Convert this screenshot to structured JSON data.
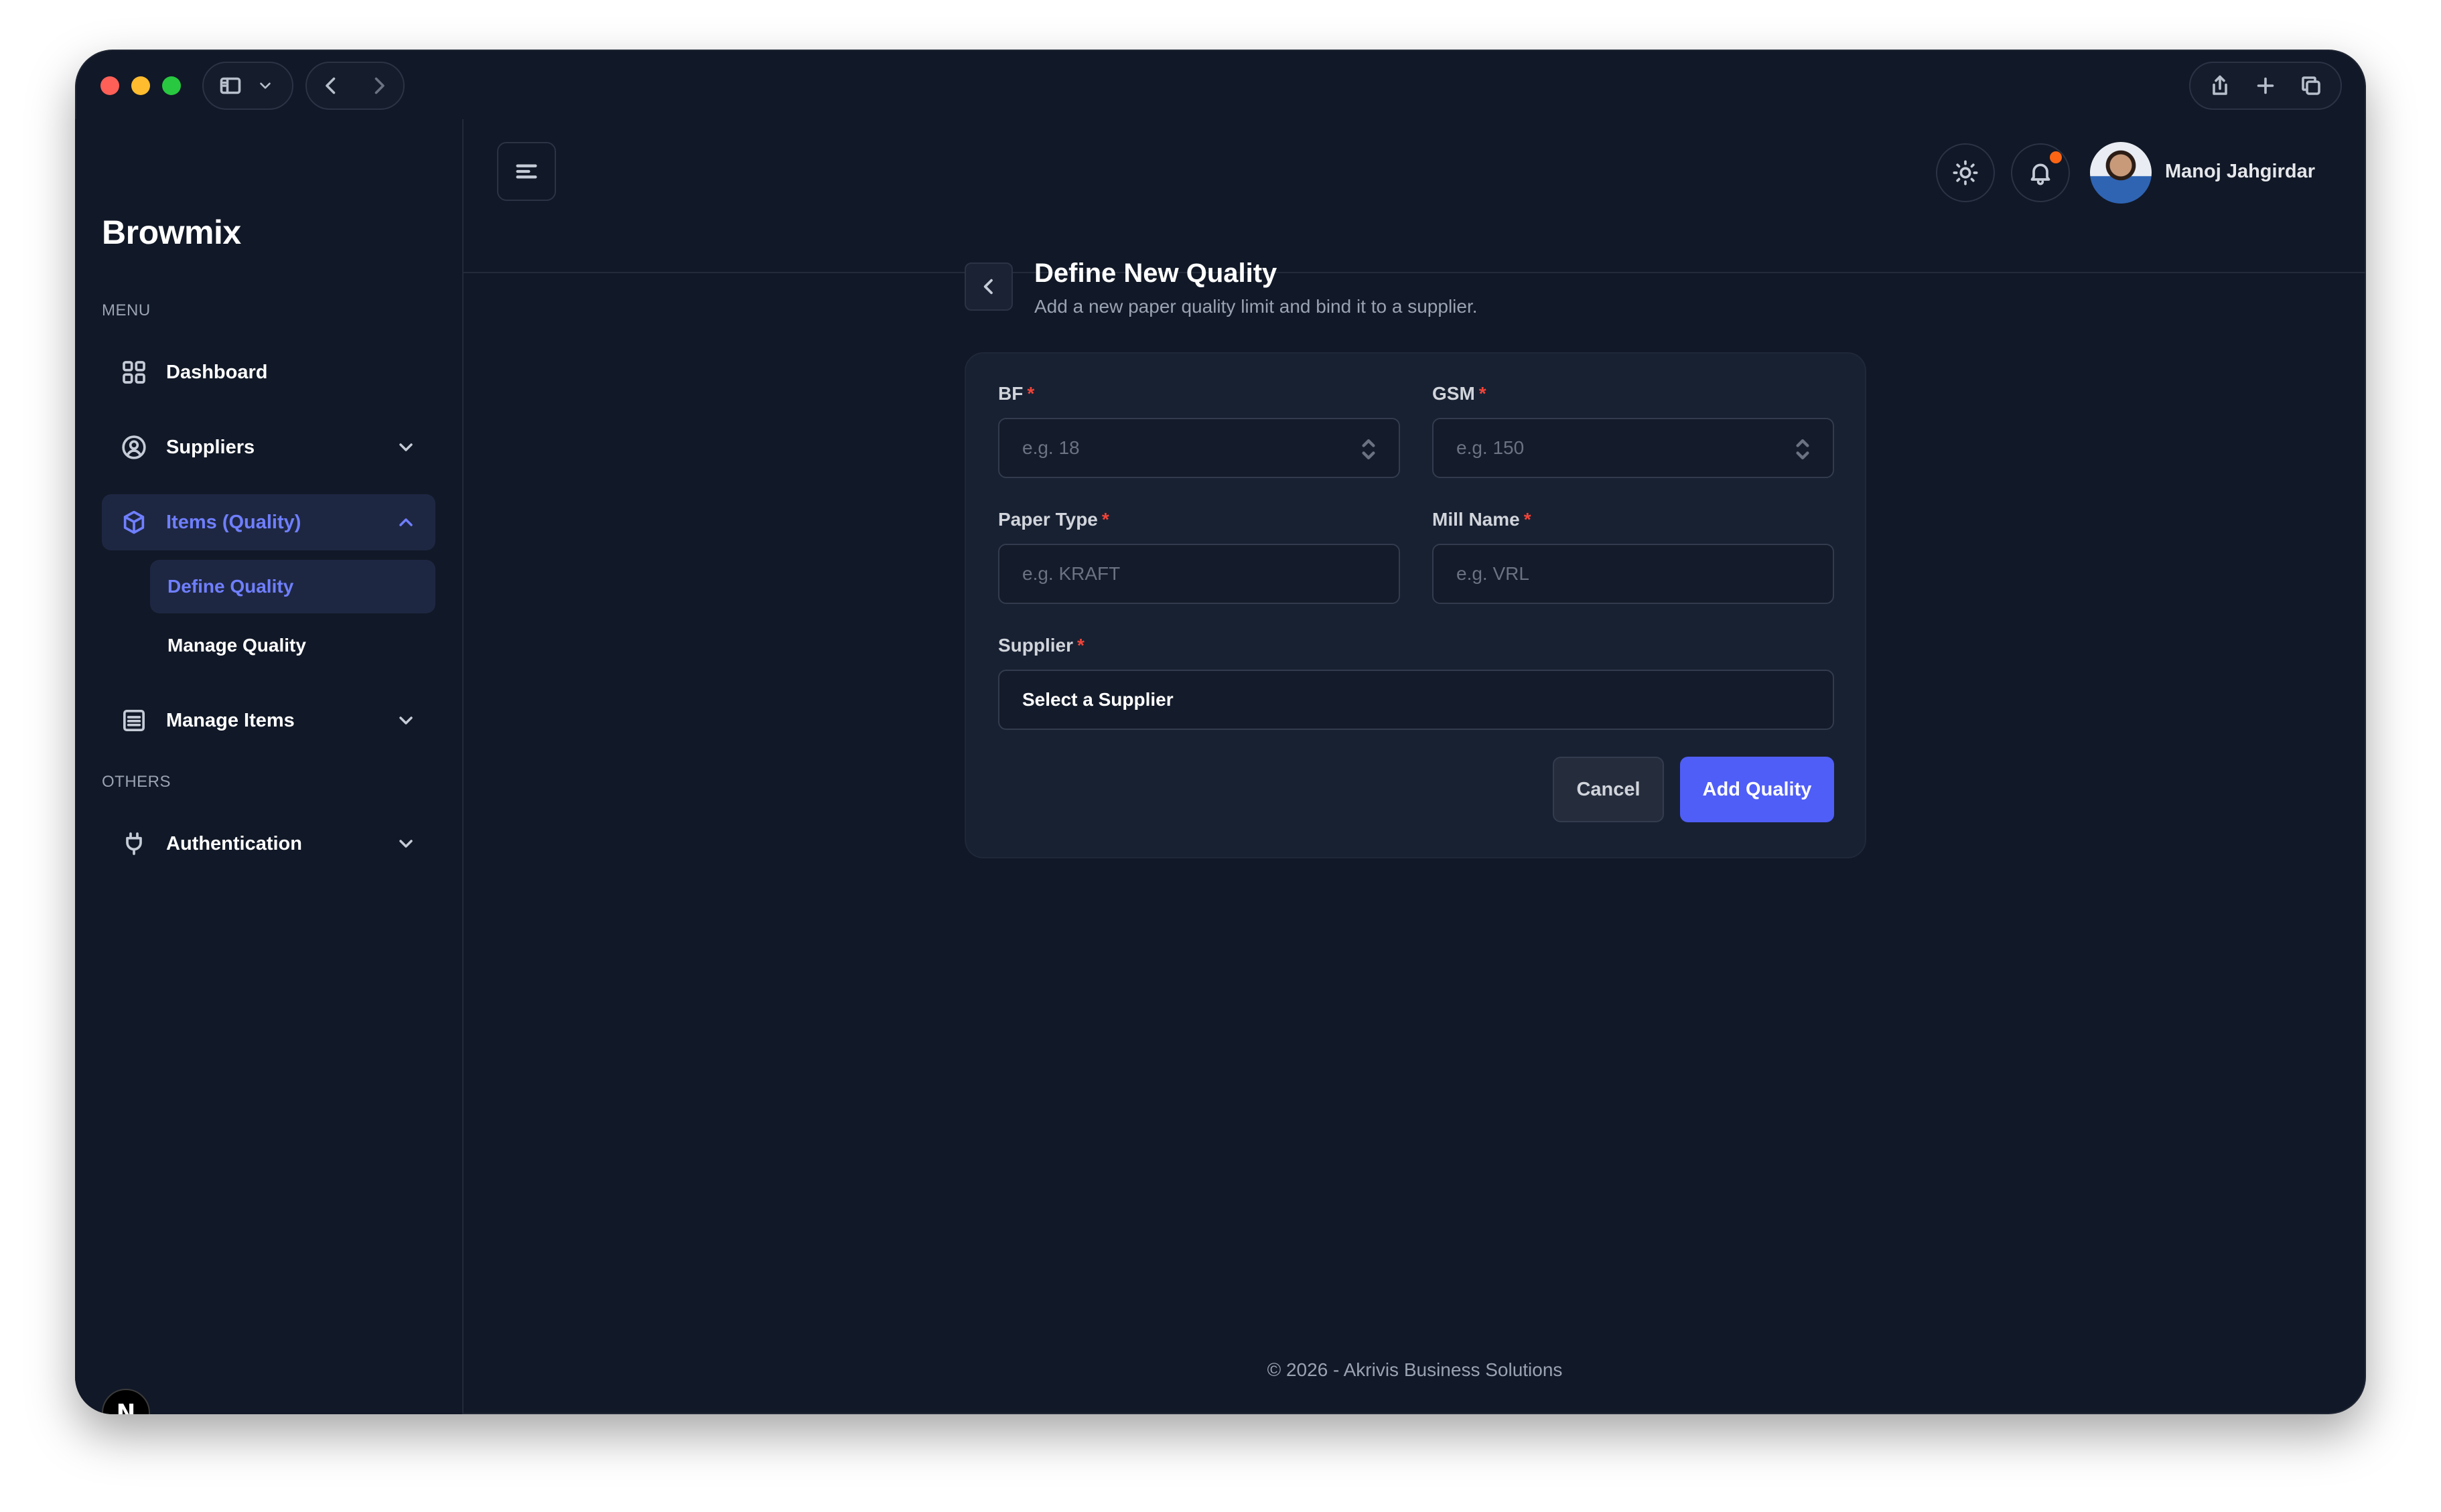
{
  "brand": "Browmix",
  "sidebar": {
    "menu_label": "MENU",
    "others_label": "OTHERS",
    "items": [
      {
        "label": "Dashboard"
      },
      {
        "label": "Suppliers"
      },
      {
        "label": "Items (Quality)"
      },
      {
        "label": "Manage Items"
      },
      {
        "label": "Authentication"
      }
    ],
    "sub_items": [
      {
        "label": "Define Quality"
      },
      {
        "label": "Manage Quality"
      }
    ],
    "dev_badge": "N"
  },
  "header": {
    "user_name": "Manoj Jahgirdar",
    "notification_color": "#fb6514"
  },
  "page": {
    "title": "Define New Quality",
    "subtitle": "Add a new paper quality limit and bind it to a supplier."
  },
  "form": {
    "bf": {
      "label": "BF",
      "placeholder": "e.g. 18"
    },
    "gsm": {
      "label": "GSM",
      "placeholder": "e.g. 150"
    },
    "paper_type": {
      "label": "Paper Type",
      "placeholder": "e.g. KRAFT"
    },
    "mill_name": {
      "label": "Mill Name",
      "placeholder": "e.g. VRL"
    },
    "supplier": {
      "label": "Supplier",
      "value": "Select a Supplier"
    },
    "required_mark": "*",
    "cancel_label": "Cancel",
    "submit_label": "Add Quality"
  },
  "footer": "© 2026 - Akrivis Business Solutions",
  "colors": {
    "accent": "#4f5ef7",
    "active_text": "#6f7fff",
    "background": "#111827",
    "required": "#f04438"
  }
}
